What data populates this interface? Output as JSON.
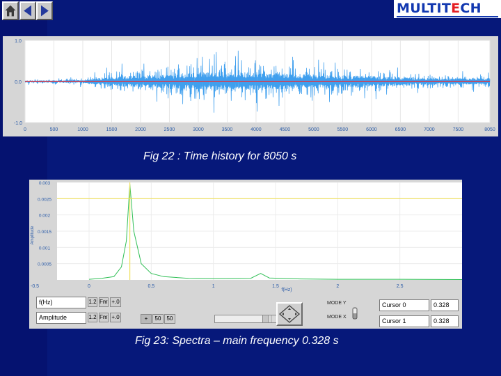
{
  "nav": {
    "icons": [
      "home-icon",
      "back-arrow-icon",
      "forward-arrow-icon"
    ]
  },
  "logo": {
    "part1": "MULTIT",
    "part2": "E",
    "part3": "CH"
  },
  "colors": {
    "slide_background": "#06187a",
    "trace": "#3f9fee",
    "mean_line": "#ff2020",
    "spectrum_line": "#2fbf55",
    "cursor_line": "#efe05a",
    "panel": "#d6d6d6"
  },
  "chart_data": [
    {
      "type": "line",
      "title": "",
      "xlabel": "",
      "ylabel": "",
      "xlim": [
        0,
        8050
      ],
      "ylim": [
        -1,
        1
      ],
      "x_ticks": [
        "0",
        "500",
        "1000",
        "1500",
        "2000",
        "2500",
        "3000",
        "3500",
        "4000",
        "4500",
        "5000",
        "5500",
        "6000",
        "6500",
        "7000",
        "7500",
        "8050"
      ],
      "y_ticks": [
        "1.0",
        "0.0",
        "-1.0"
      ],
      "grid": true,
      "series": [
        {
          "x": [
            0,
            500,
            1000,
            1500,
            2000,
            2500,
            3000,
            3500,
            4000,
            4500,
            5000,
            5500,
            6000,
            6500,
            7000,
            7500,
            8050
          ],
          "envelope": [
            0.08,
            0.1,
            0.15,
            0.4,
            0.5,
            0.55,
            0.75,
            0.8,
            0.75,
            0.65,
            0.6,
            0.5,
            0.45,
            0.35,
            0.3,
            0.25,
            0.28
          ]
        }
      ],
      "mean": 0.0
    },
    {
      "type": "line",
      "title": "",
      "xlabel": "f(Hz)",
      "ylabel": "Amplitude",
      "xlim": [
        -0.5,
        3.0
      ],
      "ylim": [
        0,
        0.003
      ],
      "x_ticks": [
        "-0.5",
        "0",
        "0.5",
        "1",
        "1.5",
        "2",
        "2.5"
      ],
      "y_ticks": [
        "0.003",
        "0.0025",
        "0.002",
        "0.0015",
        "0.001",
        "0.0005"
      ],
      "grid": true,
      "series": [
        {
          "x": [
            0.0,
            0.1,
            0.2,
            0.26,
            0.3,
            0.328,
            0.36,
            0.42,
            0.5,
            0.6,
            0.8,
            1.0,
            1.3,
            1.38,
            1.45,
            1.7,
            2.0,
            2.5,
            3.0
          ],
          "y": [
            2e-05,
            5e-05,
            0.0001,
            0.0004,
            0.0012,
            0.00295,
            0.0015,
            0.0005,
            0.0002,
            0.0001,
            5e-05,
            4e-05,
            5e-05,
            0.0002,
            6e-05,
            3e-05,
            2e-05,
            2e-05,
            1e-05
          ]
        }
      ],
      "cursor": {
        "x": 0.328,
        "y": 0.0025
      }
    }
  ],
  "captions": {
    "fig22": "Fig 22 : Time history for 8050 s",
    "fig23": "Fig  23: Spectra – main frequency 0.328 s"
  },
  "controls": {
    "field1": "f(Hz)",
    "field2": "Amplitude",
    "fmt_btns": [
      "1.2",
      "Fmt",
      "+.0"
    ],
    "zoom_btns": [
      "+",
      "50",
      "50"
    ],
    "mode_y": "MODE Y",
    "mode_x": "MODE X",
    "cursor0_name": "Cursor 0",
    "cursor0_value": "0.328",
    "cursor1_name": "Cursor 1",
    "cursor1_value": "0.328"
  }
}
